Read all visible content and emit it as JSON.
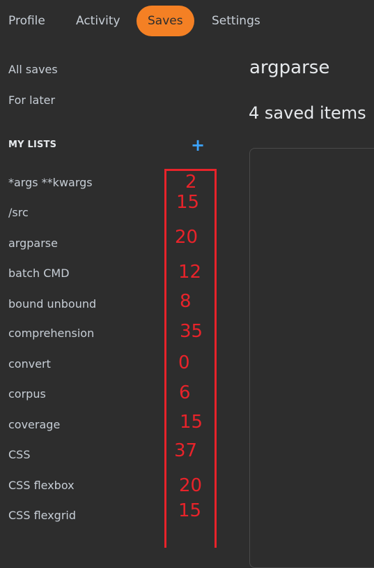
{
  "tabs": [
    {
      "label": "Profile",
      "active": false
    },
    {
      "label": "Activity",
      "active": false
    },
    {
      "label": "Saves",
      "active": true
    },
    {
      "label": "Settings",
      "active": false
    }
  ],
  "sidebar": {
    "links": [
      {
        "label": "All saves"
      },
      {
        "label": "For later"
      }
    ],
    "lists_title": "MY LISTS",
    "add_icon": "plus-icon",
    "lists": [
      {
        "label": "*args **kwargs"
      },
      {
        "label": "/src"
      },
      {
        "label": "argparse"
      },
      {
        "label": "batch CMD"
      },
      {
        "label": "bound unbound"
      },
      {
        "label": "comprehension"
      },
      {
        "label": "convert"
      },
      {
        "label": "corpus"
      },
      {
        "label": "coverage"
      },
      {
        "label": "CSS"
      },
      {
        "label": "CSS flexbox"
      },
      {
        "label": "CSS flexgrid"
      }
    ]
  },
  "main": {
    "title": "argparse",
    "count_label": "4 saved items"
  },
  "annotation": {
    "color": "#e8232a",
    "numbers": [
      "2",
      "15",
      "20",
      "12",
      "8",
      "35",
      "0",
      "6",
      "15",
      "37",
      "20",
      "15"
    ]
  },
  "colors": {
    "accent": "#f48024",
    "add_icon": "#3ca4ff",
    "background": "#2d2d2d"
  }
}
